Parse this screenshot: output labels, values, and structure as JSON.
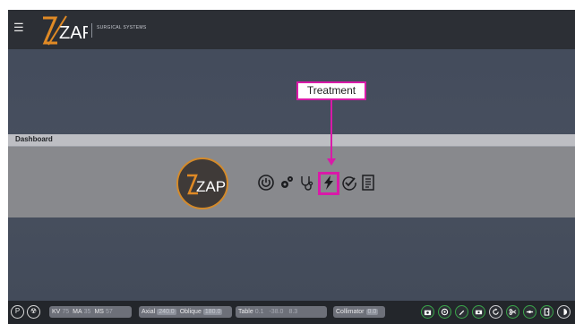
{
  "header": {
    "logo_text": "ZAP",
    "subtitle": "SURGICAL SYSTEMS",
    "menu_icon": "hamburger-icon"
  },
  "dashboard": {
    "title": "Dashboard",
    "logo_text": "ZAP",
    "tools": [
      {
        "name": "power-icon"
      },
      {
        "name": "gears-icon"
      },
      {
        "name": "stethoscope-icon"
      },
      {
        "name": "lightning-icon"
      },
      {
        "name": "check-icon"
      },
      {
        "name": "document-icon"
      }
    ]
  },
  "callout": {
    "label": "Treatment",
    "color": "#d91aa8"
  },
  "statusbar": {
    "left_buttons": [
      "P",
      "☢"
    ],
    "kv_label": "KV",
    "kv_value": "75",
    "ma_label": "MA",
    "ma_value": "35",
    "ms_label": "MS",
    "ms_value": "57",
    "axial_label": "Axial",
    "axial_value": "240.0",
    "oblique_label": "Oblique",
    "oblique_value": "180.0",
    "table_label": "Table",
    "table_x": "0.1",
    "table_y": "-38.0",
    "table_z": "8.3",
    "collimator_label": "Collimator",
    "collimator_value": "0.0"
  }
}
